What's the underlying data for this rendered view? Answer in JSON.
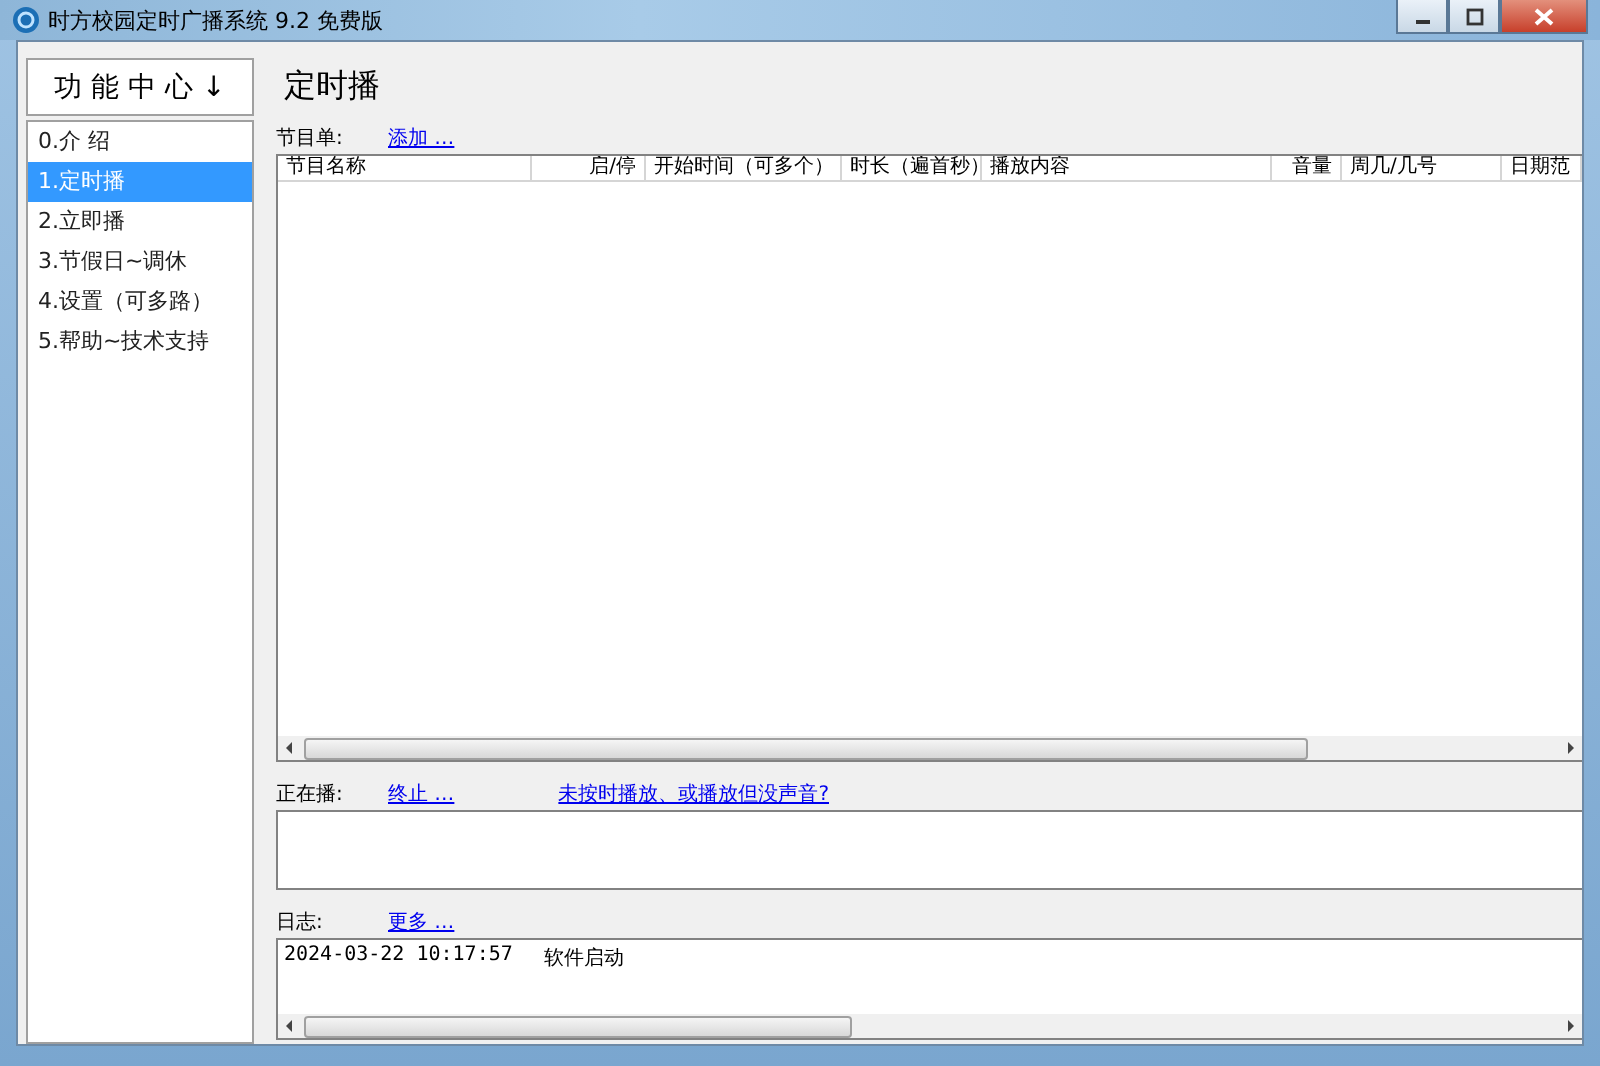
{
  "window": {
    "title": "时方校园定时广播系统 9.2 免费版"
  },
  "sidebar": {
    "header": "功 能 中 心 ↓",
    "items": [
      {
        "label": "0.介 绍",
        "selected": false
      },
      {
        "label": "1.定时播",
        "selected": true
      },
      {
        "label": "2.立即播",
        "selected": false
      },
      {
        "label": "3.节假日~调休",
        "selected": false
      },
      {
        "label": "4.设置（可多路）",
        "selected": false
      },
      {
        "label": "5.帮助~技术支持",
        "selected": false
      }
    ]
  },
  "page_title": "定时播",
  "program_list": {
    "label": "节目单:",
    "link": "添加 …",
    "columns": [
      "节目名称",
      "启/停",
      "开始时间（可多个）",
      "时长（遍首秒）",
      "播放内容",
      "音量",
      "周几/几号",
      "日期范"
    ]
  },
  "now_playing": {
    "label": "正在播:",
    "links": [
      "终止 …",
      "未按时播放、或播放但没声音?"
    ]
  },
  "log": {
    "label": "日志:",
    "link": "更多 …",
    "entries": [
      {
        "time": "2024-03-22 10:17:57",
        "message": "软件启动"
      }
    ]
  }
}
